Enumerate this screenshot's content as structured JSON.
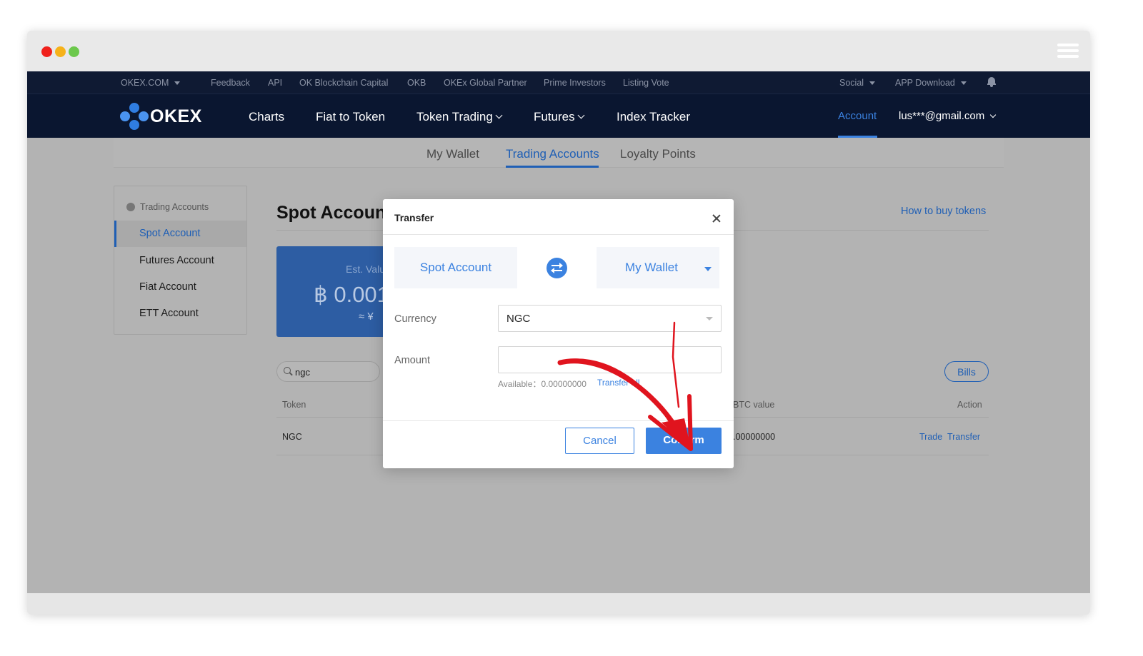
{
  "window": {
    "traffic_lights": [
      "close",
      "minimize",
      "maximize"
    ]
  },
  "topbar": {
    "site": "OKEX.COM",
    "links": [
      "Feedback",
      "API",
      "OK Blockchain Capital",
      "OKB",
      "OKEx Global Partner",
      "Prime Investors",
      "Listing Vote"
    ],
    "social": "Social",
    "app_download": "APP Download"
  },
  "mainnav": {
    "logo_text": "OKEX",
    "links": [
      "Charts",
      "Fiat to Token",
      "Token Trading",
      "Futures",
      "Index Tracker"
    ],
    "account": "Account",
    "email": "lus***@gmail.com"
  },
  "subnav": {
    "tabs": [
      "My Wallet",
      "Trading Accounts",
      "Loyalty Points"
    ],
    "active": "Trading Accounts"
  },
  "sidebar": {
    "heading": "Trading Accounts",
    "items": [
      "Spot Account",
      "Futures Account",
      "Fiat Account",
      "ETT Account"
    ],
    "active": "Spot Account"
  },
  "main": {
    "title": "Spot Accoun",
    "how_to": "How to buy tokens",
    "est_label": "Est. Valu",
    "est_value": "฿ 0.001",
    "est_cny": "≈ ¥",
    "search_value": "ngc",
    "bills": "Bills",
    "table": {
      "headers": [
        "Token",
        "BTC value",
        "Action"
      ],
      "rows": [
        {
          "token": "NGC",
          "btc_value": ".00000000",
          "actions": [
            "Trade",
            "Transfer"
          ]
        }
      ]
    }
  },
  "modal": {
    "title": "Transfer",
    "from_account": "Spot Account",
    "to_account": "My Wallet",
    "currency_label": "Currency",
    "currency_value": "NGC",
    "amount_label": "Amount",
    "amount_value": "",
    "available_text": "Available：0.00000000",
    "transfer_all": "Transfer all",
    "cancel": "Cancel",
    "confirm": "Confirm"
  },
  "colors": {
    "nav_bg": "#0a1630",
    "accent": "#3b82e0",
    "annotation_arrow": "#e0141e"
  }
}
